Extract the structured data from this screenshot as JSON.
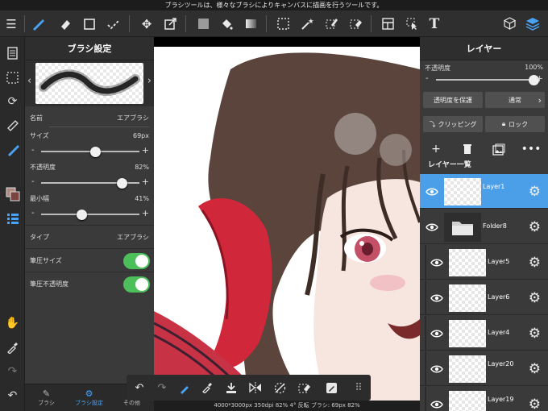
{
  "tip": "ブラシツールは、様々なブラシによりキャンバスに描画を行うツールです。",
  "toolbar": {
    "text_tool": "T"
  },
  "brush_panel": {
    "title": "ブラシ設定",
    "name_label": "名前",
    "name_value": "エアブラシ",
    "size_label": "サイズ",
    "size_value": "69px",
    "size_level": 0.55,
    "opacity_label": "不透明度",
    "opacity_value": "82%",
    "opacity_level": 0.82,
    "minwidth_label": "最小幅",
    "minwidth_value": "41%",
    "minwidth_level": 0.41,
    "type_label": "タイプ",
    "type_value": "エアブラシ",
    "pressure_size_label": "筆圧サイズ",
    "pressure_opacity_label": "筆圧不透明度",
    "minus": "-",
    "plus": "+"
  },
  "brush_tabs": [
    {
      "label": "ブラシ"
    },
    {
      "label": "ブラシ設定"
    },
    {
      "label": "その他"
    }
  ],
  "status": "4000*3000px 350dpi 82% 4° 反転 ブラシ: 69px 82%",
  "layer_panel": {
    "title": "レイヤー",
    "opacity_label": "不透明度",
    "opacity_value": "100%",
    "opacity_level": 1.0,
    "protect_label": "透明度を保護",
    "blend_label": "通常",
    "clipping_label": "クリッピング",
    "lock_label": "ロック",
    "list_header": "レイヤー一覧",
    "layers": [
      {
        "name": "Layer1",
        "active": true
      },
      {
        "name": "Folder8",
        "active": false
      },
      {
        "name": "Layer5",
        "active": false
      },
      {
        "name": "Layer6",
        "active": false
      },
      {
        "name": "Layer4",
        "active": false
      },
      {
        "name": "Layer20",
        "active": false
      },
      {
        "name": "Layer19",
        "active": false
      }
    ]
  },
  "colors": {
    "accent": "#4aa3f5",
    "toggle_on": "#4cbf5a",
    "active_layer": "#4a9fe8"
  }
}
